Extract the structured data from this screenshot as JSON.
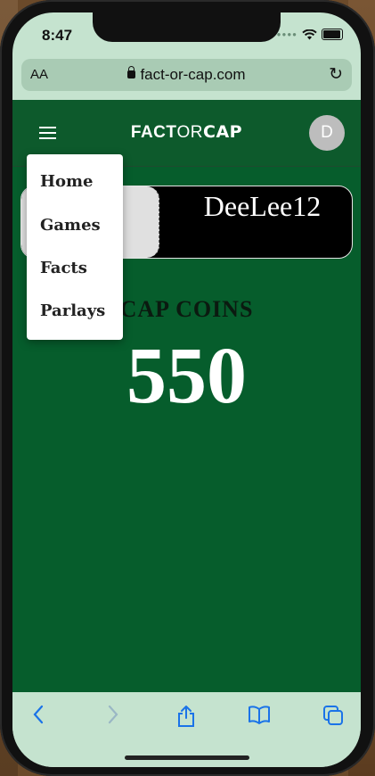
{
  "status_bar": {
    "time": "8:47"
  },
  "browser": {
    "text_size_label": "AA",
    "url": "fact-or-cap.com"
  },
  "navbar": {
    "logo_fact": "FACT",
    "logo_or": "OR",
    "logo_cap": "CAP",
    "avatar_initial": "D"
  },
  "profile": {
    "username": "DeeLee12"
  },
  "coins": {
    "label": "CAP COINS",
    "value": "550"
  },
  "menu": {
    "items": [
      {
        "label": "Home"
      },
      {
        "label": "Games"
      },
      {
        "label": "Facts"
      },
      {
        "label": "Parlays"
      }
    ]
  },
  "toolbar": {
    "icons": [
      "back-icon",
      "forward-icon",
      "share-icon",
      "bookmarks-icon",
      "tabs-icon"
    ]
  },
  "colors": {
    "app_background": "#065d2c",
    "navbar": "#0d5a2c",
    "browser_chrome": "#c5e3cf",
    "accent_blue": "#1a73e8"
  }
}
